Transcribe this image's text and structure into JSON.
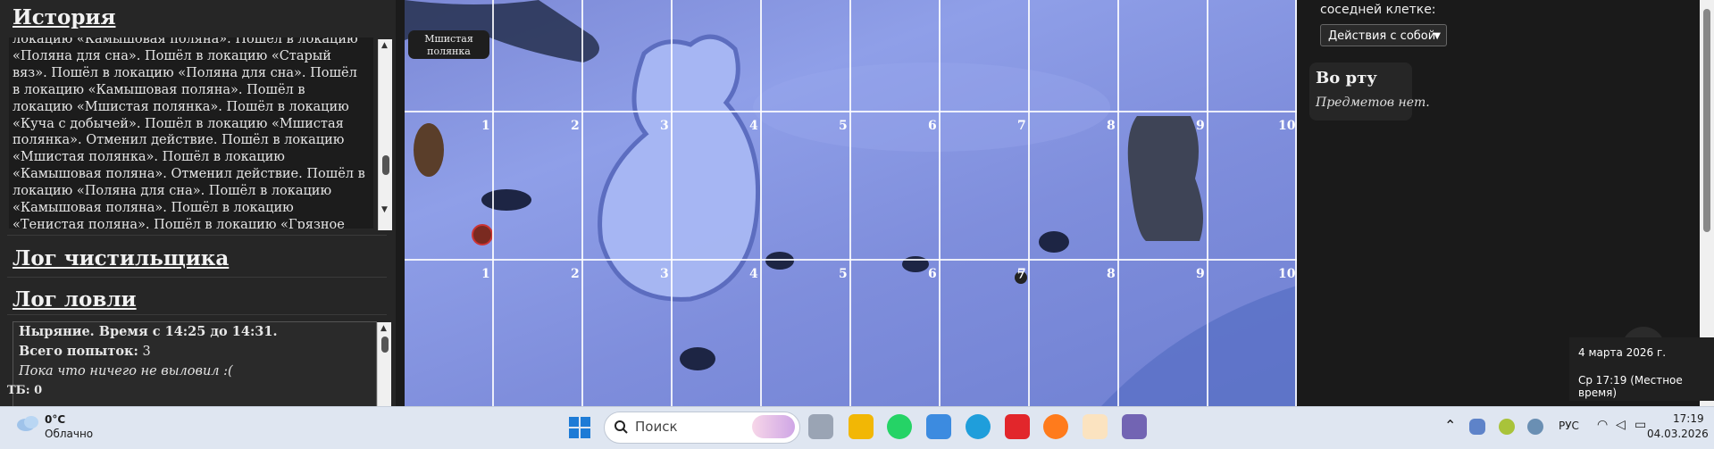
{
  "left_panel": {
    "history_title": "История",
    "history_text": "локацию «Камышовая поляна». Пошёл в локацию «Поляна для сна». Пошёл в локацию «Старый вяз». Пошёл в локацию «Поляна для сна». Пошёл в локацию «Камышовая поляна». Пошёл в локацию «Мшистая полянка». Пошёл в локацию «Куча с добычей». Пошёл в локацию «Мшистая полянка». Отменил действие. Пошёл в локацию «Мшистая полянка». Пошёл в локацию «Камышовая поляна». Отменил действие. Пошёл в локацию «Поляна для сна». Пошёл в локацию «Камышовая поляна». Пошёл в локацию «Тенистая поляна». Пошёл в локацию «Грязное место». Пошёл в локацию «Тенистая поляна». Пошёл в локацию «Мшистая полянка». Пошёл в локацию «Куча с добычей». Пошёл в локацию",
    "cleaner_log_title": "Лог чистильщика",
    "fishing_log_title": "Лог ловли",
    "fishing": {
      "line1": "Ныряние. Время с 14:25 до 14:31.",
      "attempts_label": "Всего попыток:",
      "attempts_value": "3",
      "status": "Пока что ничего не выловил :("
    },
    "tb": "ТБ: 0"
  },
  "field": {
    "location_name": "Мшистая полянка",
    "row1_numbers": [
      "1",
      "2",
      "3",
      "4",
      "5",
      "6",
      "7",
      "8",
      "9",
      "10"
    ],
    "row2_numbers": [
      "1",
      "2",
      "3",
      "4",
      "5",
      "6",
      "7",
      "8",
      "9",
      "10"
    ],
    "marker_number": "7",
    "colors": {
      "field": "#8796e2",
      "grid": "#ffffff"
    }
  },
  "right_panel": {
    "cell_label": "соседней клетке:",
    "actions_select": "Действия с собой",
    "mouth_title": "Во рту",
    "mouth_empty": "Предметов нет."
  },
  "date_tooltip": {
    "date": "4 марта 2026 г.",
    "time": "Ср 17:19 (Местное время)"
  },
  "taskbar": {
    "weather_temp": "0°C",
    "weather_desc": "Облачно",
    "search_placeholder": "Поиск",
    "lang": "РУС",
    "clock_time": "17:19",
    "clock_date": "04.03.2026"
  }
}
